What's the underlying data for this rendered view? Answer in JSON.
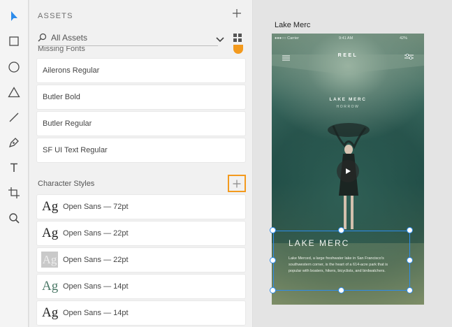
{
  "assets": {
    "header": "ASSETS",
    "search_placeholder": "All Assets",
    "missing_fonts_label": "Missing Fonts",
    "fonts": [
      "Ailerons Regular",
      "Butler Bold",
      "Butler Regular",
      "SF UI Text Regular"
    ],
    "character_styles_title": "Character Styles",
    "character_styles": [
      {
        "glyph": "Ag",
        "label": "Open Sans — 72pt",
        "variant": "plain"
      },
      {
        "glyph": "Ag",
        "label": "Open Sans — 22pt",
        "variant": "plain"
      },
      {
        "glyph": "Ag",
        "label": "Open Sans — 22pt",
        "variant": "boxed"
      },
      {
        "glyph": "Ag",
        "label": "Open Sans — 14pt",
        "variant": "green"
      },
      {
        "glyph": "Ag",
        "label": "Open Sans — 14pt",
        "variant": "plain"
      }
    ]
  },
  "canvas": {
    "artboard_title": "Lake Merc",
    "status_carrier": "●●●○○ Carrier",
    "status_time": "9:41 AM",
    "status_battery": "42%",
    "app_title": "REEL",
    "hero_title": "LAKE MERC",
    "hero_subtitle": "HORROW",
    "card_title": "LAKE MERC",
    "card_body": "Lake Merced, a large freshwater lake in San Francisco's southwestern corner, is the heart of a 614-acre park that is popular with boaters, hikers, bicyclists, and birdwatchers."
  },
  "colors": {
    "accent_orange": "#f39a1e",
    "selection_blue": "#2d8ceb"
  }
}
